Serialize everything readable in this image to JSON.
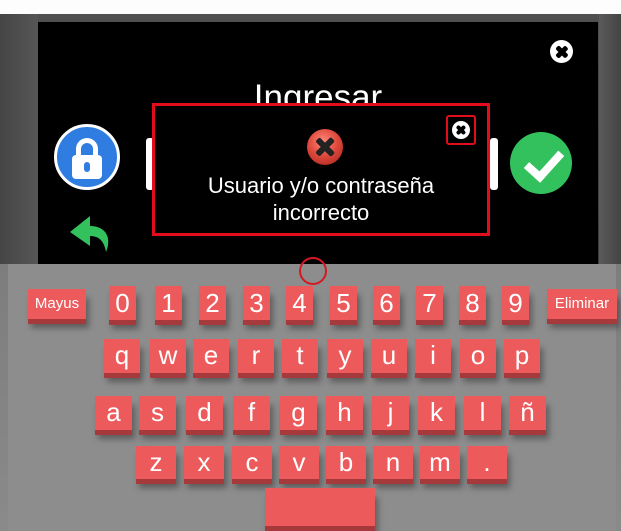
{
  "panel": {
    "title": "Ingresar",
    "close_icon": "close-x-circle-icon",
    "lock_icon": "lock-icon",
    "back_icon": "undo-arrow-icon",
    "confirm_icon": "checkmark-icon"
  },
  "dialog": {
    "icon": "error-x-icon",
    "close_icon": "close-x-circle-icon",
    "message_line1": "Usuario y/o contraseña",
    "message_line2": "incorrecto"
  },
  "keyboard": {
    "rows": [
      [
        "Mayus",
        "0",
        "1",
        "2",
        "3",
        "4",
        "5",
        "6",
        "7",
        "8",
        "9",
        "Eliminar"
      ],
      [
        "q",
        "w",
        "e",
        "r",
        "t",
        "y",
        "u",
        "i",
        "o",
        "p"
      ],
      [
        "a",
        "s",
        "d",
        "f",
        "g",
        "h",
        "j",
        "k",
        "l",
        "ñ"
      ],
      [
        "z",
        "x",
        "c",
        "v",
        "b",
        "n",
        "m",
        "."
      ],
      [
        ""
      ]
    ]
  },
  "colors": {
    "key": "#ec5a5c",
    "dialog_border": "#e10d1d",
    "lock_button": "#2f7de0",
    "confirm_button": "#33c15e",
    "back_arrow": "#33c15e"
  }
}
